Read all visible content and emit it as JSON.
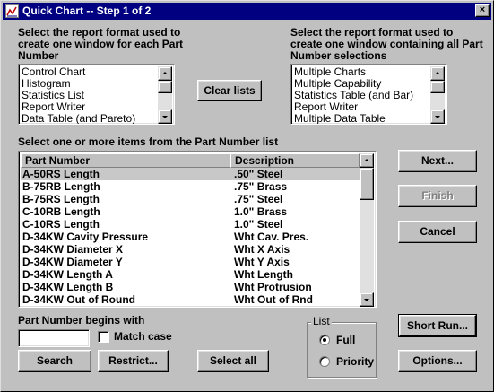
{
  "window": {
    "title": "Quick Chart -- Step 1 of 2"
  },
  "left_section": {
    "label_line1": "Select the report format used to",
    "label_line2": "create one window for each Part",
    "label_line3": "Number",
    "items": [
      "Control Chart",
      "Histogram",
      "Statistics List",
      "Report Writer",
      "Data Table (and Pareto)"
    ]
  },
  "right_section": {
    "label_line1": "Select the report format used to",
    "label_line2": "create one window containing all Part",
    "label_line3": "Number selections",
    "items": [
      "Multiple Charts",
      "Multiple Capability",
      "Statistics Table (and Bar)",
      "Report Writer",
      "Multiple Data Table"
    ]
  },
  "clear_lists_button": "Clear lists",
  "part_list": {
    "label": "Select one or more items from the Part Number list",
    "columns": [
      "Part Number",
      "Description"
    ],
    "rows": [
      {
        "part": "A-50RS Length",
        "desc": ".50\" Steel",
        "selected": true
      },
      {
        "part": "B-75RB Length",
        "desc": ".75\" Brass"
      },
      {
        "part": "B-75RS Length",
        "desc": ".75\" Steel"
      },
      {
        "part": "C-10RB Length",
        "desc": "1.0\" Brass"
      },
      {
        "part": "C-10RS Length",
        "desc": "1.0\" Steel"
      },
      {
        "part": "D-34KW Cavity Pressure",
        "desc": "Wht Cav. Pres."
      },
      {
        "part": "D-34KW Diameter X",
        "desc": "Wht X Axis"
      },
      {
        "part": "D-34KW Diameter Y",
        "desc": "Wht Y Axis"
      },
      {
        "part": "D-34KW Length A",
        "desc": "Wht Length"
      },
      {
        "part": "D-34KW Length B",
        "desc": "Wht Protrusion"
      },
      {
        "part": "D-34KW Out of Round",
        "desc": "Wht Out of Rnd"
      }
    ]
  },
  "buttons": {
    "next": "Next...",
    "finish": "Finish",
    "cancel": "Cancel",
    "short_run": "Short Run...",
    "options": "Options...",
    "search": "Search",
    "restrict": "Restrict...",
    "select_all": "Select all"
  },
  "begins_with": {
    "label": "Part Number begins with",
    "value": "",
    "match_case_label": "Match case",
    "match_case_checked": false
  },
  "list_group": {
    "legend": "List",
    "options": [
      "Full",
      "Priority"
    ],
    "selected": "Full"
  }
}
